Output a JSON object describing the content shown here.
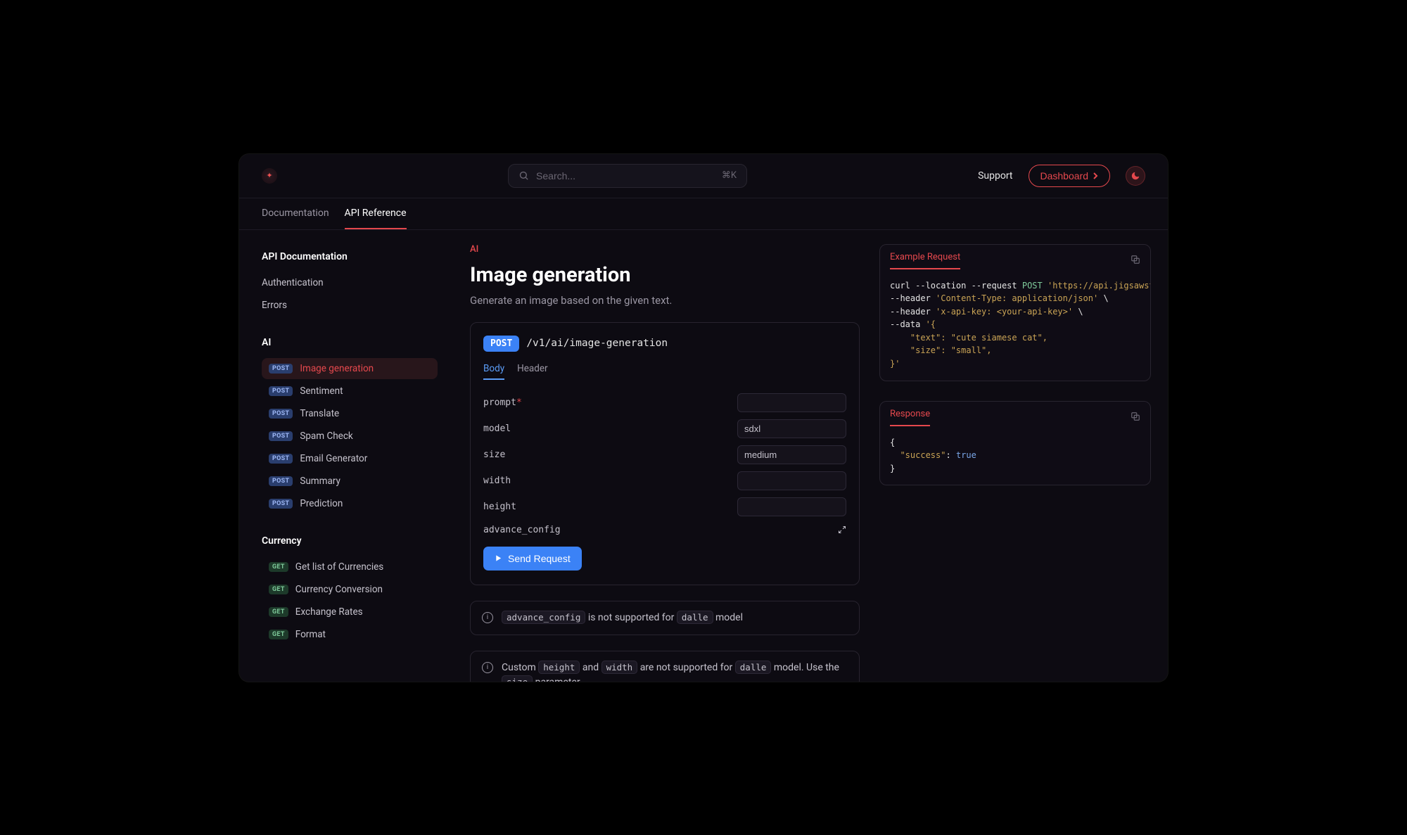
{
  "header": {
    "search_placeholder": "Search...",
    "kbd": "⌘K",
    "support": "Support",
    "dashboard": "Dashboard"
  },
  "tabs": [
    {
      "label": "Documentation",
      "active": false
    },
    {
      "label": "API Reference",
      "active": true
    }
  ],
  "sidebar": {
    "section1_title": "API Documentation",
    "items1": [
      "Authentication",
      "Errors"
    ],
    "section2_title": "AI",
    "items2": [
      {
        "method": "POST",
        "label": "Image generation",
        "active": true
      },
      {
        "method": "POST",
        "label": "Sentiment"
      },
      {
        "method": "POST",
        "label": "Translate"
      },
      {
        "method": "POST",
        "label": "Spam Check"
      },
      {
        "method": "POST",
        "label": "Email Generator"
      },
      {
        "method": "POST",
        "label": "Summary"
      },
      {
        "method": "POST",
        "label": "Prediction"
      }
    ],
    "section3_title": "Currency",
    "items3": [
      {
        "method": "GET",
        "label": "Get list of Currencies"
      },
      {
        "method": "GET",
        "label": "Currency Conversion"
      },
      {
        "method": "GET",
        "label": "Exchange Rates"
      },
      {
        "method": "GET",
        "label": "Format"
      }
    ]
  },
  "main": {
    "breadcrumb": "AI",
    "title": "Image generation",
    "subtitle": "Generate an image based on the given text.",
    "method": "POST",
    "path": "/v1/ai/image-generation",
    "inner_tabs": {
      "body": "Body",
      "header": "Header"
    },
    "fields": {
      "prompt": "prompt",
      "model": "model",
      "model_value": "sdxl",
      "size": "size",
      "size_value": "medium",
      "width": "width",
      "height": "height",
      "advance": "advance_config"
    },
    "send": "Send Request",
    "note1_chip1": "advance_config",
    "note1_mid": " is not supported for ",
    "note1_chip2": "dalle",
    "note1_end": " model",
    "note2_start": "Custom ",
    "note2_chip1": "height",
    "note2_mid1": " and ",
    "note2_chip2": "width",
    "note2_mid2": " are not supported for ",
    "note2_chip3": "dalle",
    "note2_mid3": " model. Use the ",
    "note2_chip4": "size",
    "note2_end": " parameter."
  },
  "right": {
    "req_title": "Example Request",
    "resp_title": "Response",
    "curl1a": "curl --location --request ",
    "curl1b": "POST",
    "curl1c": " 'https://api.jigsawstack.com",
    "curl2a": "--header ",
    "curl2b": "'Content-Type: application/json'",
    "curl2c": " \\",
    "curl3a": "--header ",
    "curl3b": "'x-api-key: <your-api-key>'",
    "curl3c": " \\",
    "curl4a": "--data ",
    "curl4b": "'{",
    "curl5": "    \"text\": \"cute siamese cat\",",
    "curl6": "    \"size\": \"small\",",
    "curl7": "}'",
    "resp1": "{",
    "resp2a": "  \"success\"",
    "resp2b": ": ",
    "resp2c": "true",
    "resp3": "}"
  }
}
